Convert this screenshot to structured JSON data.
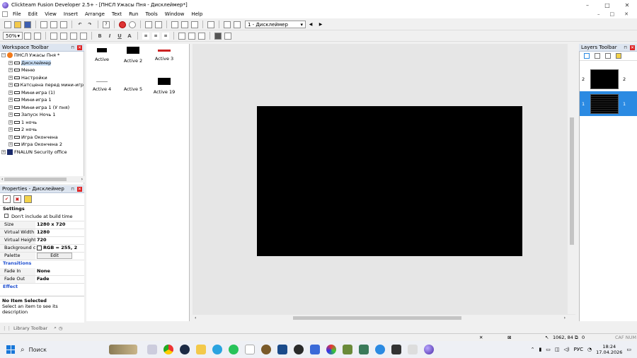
{
  "window": {
    "title": "Clickteam Fusion Developer 2.5+ - [ПНСЛ Ужасы Пня - Дисклеймер*]",
    "minimize": "–",
    "maximize": "□",
    "close": "✕"
  },
  "menu": [
    "File",
    "Edit",
    "View",
    "Insert",
    "Arrange",
    "Text",
    "Run",
    "Tools",
    "Window",
    "Help"
  ],
  "menu_right": [
    "–",
    "□",
    "✕"
  ],
  "toolbar": {
    "frame_select": "1 - Дисклеймер",
    "zoom": "50%"
  },
  "workspace": {
    "title": "Workspace Toolbar",
    "root": "ПНСЛ Ужасы Пня *",
    "frames": [
      "Дисклеймер",
      "Меню",
      "Настройки",
      "Катсцена перед мини-игр",
      "Мини-игра (1)",
      "Мини-игра 1",
      "Мини-игра 1 (У пня)",
      "Запуск Ночь 1",
      "1 ночь",
      "2 ночь",
      "Игра Окончена",
      "Игра Окончена 2"
    ],
    "extra": "FNALUN Security office"
  },
  "properties": {
    "title": "Properties - Дисклеймер",
    "sections": {
      "settings": "Settings",
      "transitions": "Transitions",
      "effect": "Effect"
    },
    "rows": {
      "dont_include": "Don't include at build time",
      "size_k": "Size",
      "size_v": "1280 x 720",
      "vw_k": "Virtual Width",
      "vw_v": "1280",
      "vh_k": "Virtual Height",
      "vh_v": "720",
      "bg_k": "Background co",
      "bg_v": "RGB = 255, 2",
      "palette_k": "Palette",
      "palette_v": "Edit",
      "fadein_k": "Fade In",
      "fadein_v": "None",
      "fadeout_k": "Fade Out",
      "fadeout_v": "Fade"
    }
  },
  "description": {
    "title": "No Item Selected",
    "text": "Select an item to see its description"
  },
  "library_tab": "Library Toolbar",
  "objects": [
    "Active",
    "Active 2",
    "Active 3",
    "Active 4",
    "Active 5",
    "Active 19"
  ],
  "layers": {
    "title": "Layers Toolbar",
    "rows": [
      {
        "index": "2",
        "label": "2"
      },
      {
        "index": "1",
        "label": "1"
      }
    ]
  },
  "status": {
    "coords": "1062, 84",
    "zero": "0",
    "flags": "CAF NUM"
  },
  "taskbar": {
    "search": "Поиск",
    "lang": "РУС",
    "time": "18:24",
    "date": "17.04.2026"
  },
  "colors": {
    "accent": "#2b8ae2",
    "frame_bg": "#000000",
    "editor_bg": "#e6e6e6"
  }
}
